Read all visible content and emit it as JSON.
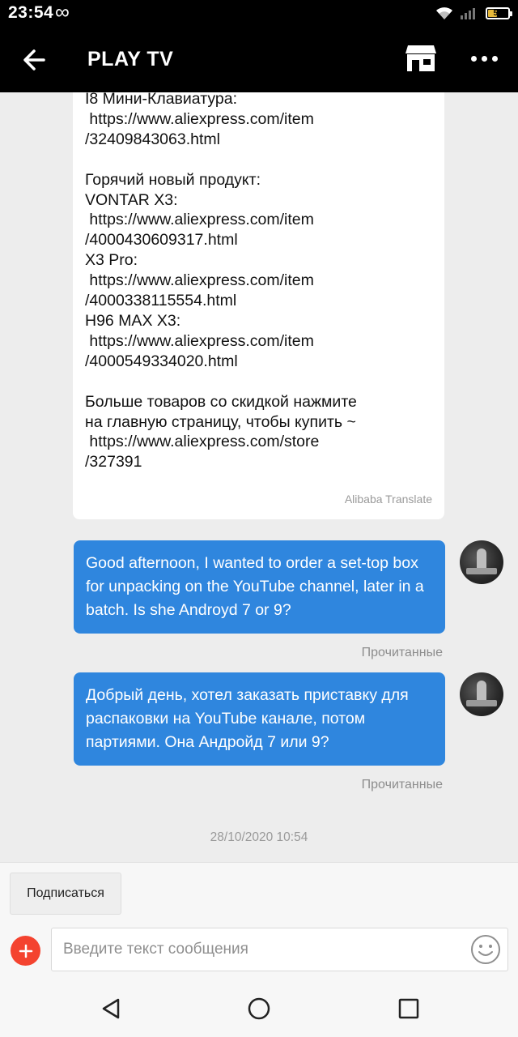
{
  "status_bar": {
    "time": "23:54",
    "infinity": "∞",
    "battery_level": "50",
    "battery_fraction": 0.5,
    "battery_color": "#e7b93a"
  },
  "header": {
    "title": "PLAY TV",
    "back_icon": "back-arrow-icon",
    "store_icon": "store-icon",
    "more_icon": "more-dots-icon"
  },
  "messages": {
    "incoming_text": "I8 Мини-Клавиатура:\n https://www.aliexpress.com/item\n/32409843063.html\n\nГорячий новый продукт:\nVONTAR X3:\n https://www.aliexpress.com/item\n/4000430609317.html\nX3 Pro:\n https://www.aliexpress.com/item\n/4000338115554.html\nH96 MAX X3:\n https://www.aliexpress.com/item\n/4000549334020.html\n\nБольше товаров со скидкой нажмите\nна главную страницу, чтобы купить ~\n https://www.aliexpress.com/store\n/327391",
    "translate_note": "Alibaba Translate",
    "outgoing": [
      {
        "text": "Good afternoon, I wanted to order a set-top box for unpacking on the YouTube channel, later in a batch. Is she Androyd 7 or 9?",
        "status": "Прочитанные"
      },
      {
        "text": "Добрый день, хотел заказать приставку для распаковки на YouTube канале, потом партиями. Она Андройд 7 или 9?",
        "status": "Прочитанные"
      }
    ],
    "timestamp": "28/10/2020 10:54",
    "bubble_color": "#2f86de"
  },
  "composer": {
    "subscribe_label": "Подписаться",
    "placeholder": "Введите текст сообщения",
    "value": "",
    "plus_color": "#f4432f"
  },
  "nav": {
    "back": "nav-back-icon",
    "home": "nav-home-icon",
    "recent": "nav-recent-icon"
  }
}
